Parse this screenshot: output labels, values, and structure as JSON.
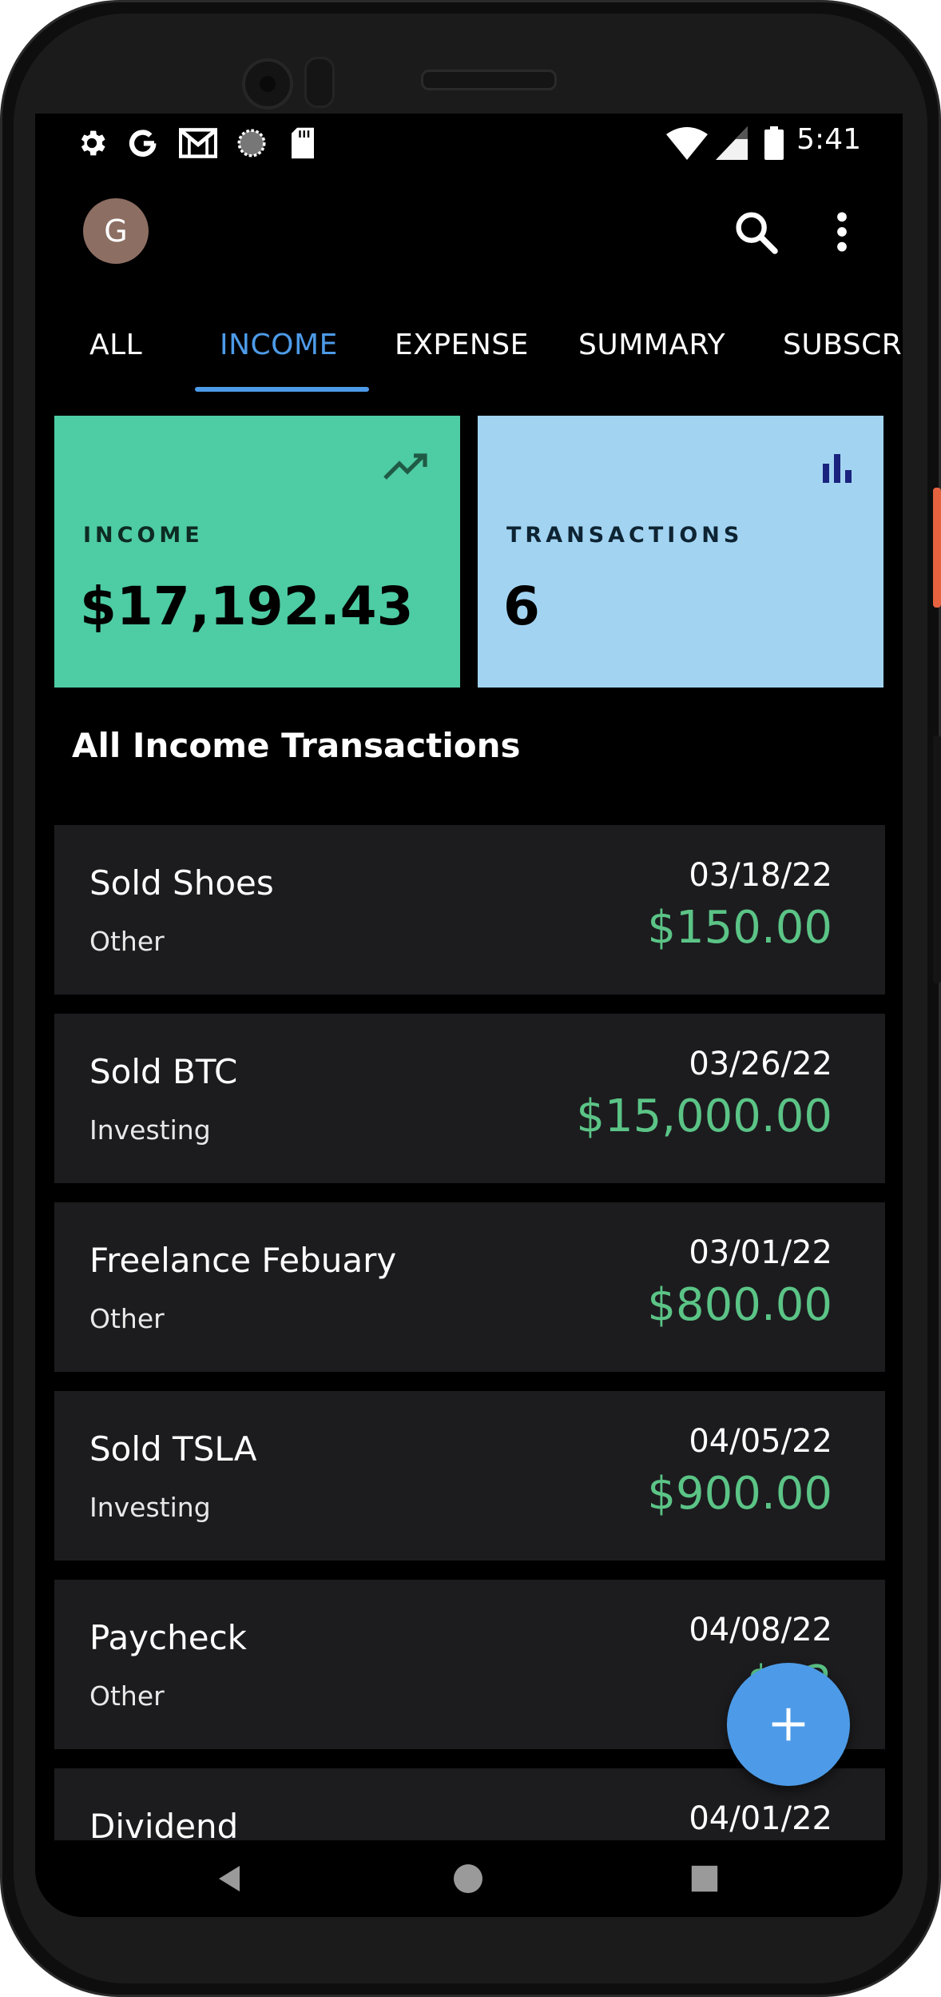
{
  "status_bar": {
    "time": "5:41",
    "left_icons": [
      "settings-icon",
      "google-icon",
      "gmail-icon",
      "sync-icon",
      "sd-card-icon"
    ],
    "right_icons": [
      "wifi-icon",
      "signal-icon",
      "battery-icon"
    ]
  },
  "app_bar": {
    "avatar_letter": "G",
    "avatar_color": "#8d6e63"
  },
  "tabs": [
    {
      "label": "ALL",
      "active": false
    },
    {
      "label": "INCOME",
      "active": true
    },
    {
      "label": "EXPENSE",
      "active": false
    },
    {
      "label": "SUMMARY",
      "active": false
    },
    {
      "label": "SUBSCR",
      "active": false
    }
  ],
  "cards": {
    "income": {
      "label": "INCOME",
      "value": "$17,192.43",
      "color": "#4ecca3",
      "icon": "trending-up-icon"
    },
    "transactions": {
      "label": "TRANSACTIONS",
      "value": "6",
      "color": "#a2d4f2",
      "icon": "bar-chart-icon"
    }
  },
  "section_title": "All Income Transactions",
  "transactions": [
    {
      "title": "Sold Shoes",
      "category": "Other",
      "date": "03/18/22",
      "amount": "$150.00"
    },
    {
      "title": "Sold BTC",
      "category": "Investing",
      "date": "03/26/22",
      "amount": "$15,000.00"
    },
    {
      "title": "Freelance Febuary",
      "category": "Other",
      "date": "03/01/22",
      "amount": "$800.00"
    },
    {
      "title": "Sold TSLA",
      "category": "Investing",
      "date": "04/05/22",
      "amount": "$900.00"
    },
    {
      "title": "Paycheck",
      "category": "Other",
      "date": "04/08/22",
      "amount": "$32"
    },
    {
      "title": "Dividend",
      "category": "",
      "date": "04/01/22",
      "amount": ""
    }
  ],
  "colors": {
    "accent": "#4d9be8",
    "amount_green": "#5bc486",
    "row_bg": "#1c1c1f"
  }
}
